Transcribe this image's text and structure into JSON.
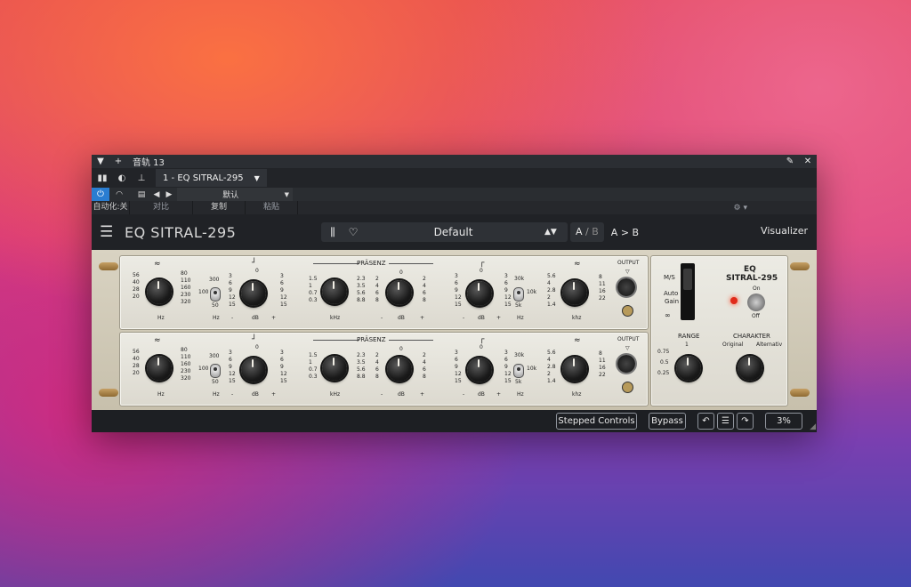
{
  "host": {
    "track_label": "音轨 13",
    "plugin_tab": "1 - EQ SITRAL-295",
    "preset_name_cn": "默认",
    "auto_label": "自动化:关",
    "compare_label": "对比",
    "copy_label": "复制",
    "paste_label": "粘贴"
  },
  "plugin": {
    "title": "EQ SITRAL-295",
    "preset": "Default",
    "ab_a": "A",
    "ab_sep": "/",
    "ab_b": "B",
    "a_to_b": "A > B",
    "visualizer": "Visualizer"
  },
  "channels": [
    {
      "id": "top"
    },
    {
      "id": "bottom"
    }
  ],
  "labels": {
    "presenz": "PRÄSENZ",
    "output": "OUTPUT",
    "hz": "Hz",
    "db": "dB",
    "khz_cap": "kHz",
    "khz": "khz",
    "minus": "-",
    "plus": "+",
    "low_left": [
      "56",
      "40",
      "28",
      "20"
    ],
    "low_right": [
      "80",
      "110",
      "160",
      "230",
      "320"
    ],
    "hp_top": "300",
    "hp_mid": "100",
    "hp_bot": "50",
    "db_left": [
      "3",
      "6",
      "9",
      "12",
      "15"
    ],
    "db_top": "0",
    "db_right": [
      "3",
      "6",
      "9",
      "12",
      "15"
    ],
    "pres_left": [
      "1.5",
      "1",
      "0.7",
      "0.3"
    ],
    "pres_right": [
      "2.3",
      "3.5",
      "5.6",
      "8.8"
    ],
    "pdb_left": [
      "2",
      "4",
      "6",
      "8"
    ],
    "pdb_right": [
      "2",
      "4",
      "6",
      "8"
    ],
    "hs_top": "30k",
    "hs_mid": "10k",
    "hs_bot": "5k",
    "hi_left": [
      "5.6",
      "4",
      "2.8",
      "2",
      "1.4"
    ],
    "hi_right": [
      "8",
      "11",
      "16",
      "22"
    ]
  },
  "right_panel": {
    "ms": "M/S",
    "auto": "Auto",
    "gain": "Gain",
    "model_line1": "EQ",
    "model_line2": "SITRAL-295",
    "on": "On",
    "off": "Off",
    "range": "RANGE",
    "range_vals": [
      "1",
      "0.75",
      "0.5",
      "0.25"
    ],
    "charakter": "CHARAKTER",
    "original": "Original",
    "alternativ": "Alternativ"
  },
  "footer": {
    "stepped": "Stepped Controls",
    "bypass": "Bypass",
    "zoom": "3%"
  },
  "colors": {
    "accent": "#2a7dd1",
    "led": "#e02a1a",
    "panel": "#e7e5dd"
  }
}
